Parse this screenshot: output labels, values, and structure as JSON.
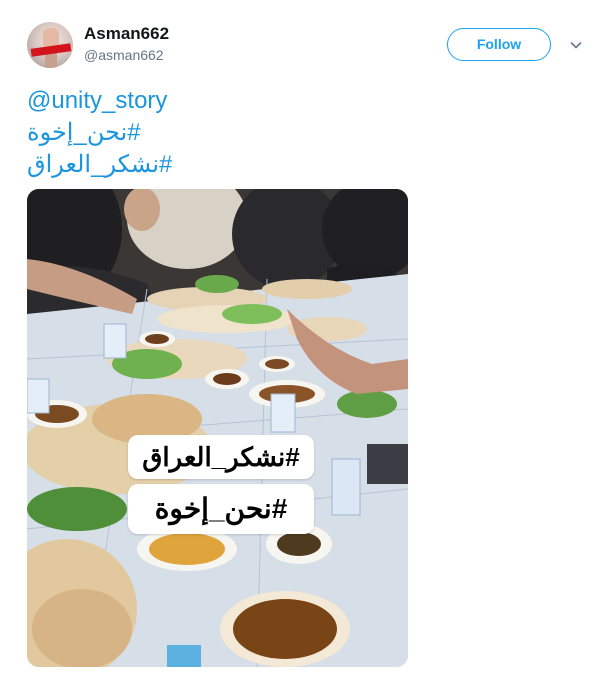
{
  "user": {
    "display_name": "Asman662",
    "handle": "@asman662"
  },
  "actions": {
    "follow_label": "Follow"
  },
  "tweet": {
    "lines": [
      "@unity_story",
      "#نحن_إخوة",
      "#نشكر_العراق"
    ]
  },
  "media": {
    "caption_top": "#نشكر_العراق",
    "caption_bottom": "#نحن_إخوة"
  },
  "colors": {
    "link": "#1b95e0",
    "follow_border": "#1da1f2",
    "handle_gray": "#657786"
  },
  "icons": {
    "more": "chevron-down-icon"
  }
}
